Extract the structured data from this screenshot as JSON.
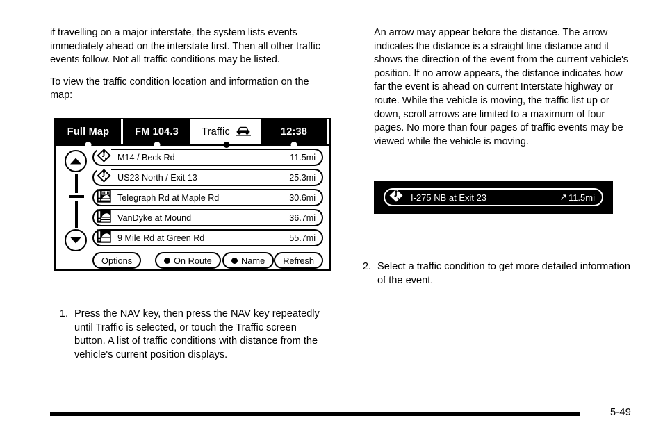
{
  "document": {
    "page_number": "5-49"
  },
  "left_column": {
    "paragraphs": [
      "if travelling on a major interstate, the system lists events immediately ahead on the interstate first. Then all other traffic events follow. Not all traffic conditions may be listed.",
      "To view the traffic condition location and information on the map:"
    ]
  },
  "right_column": {
    "paragraphs": [
      "An arrow may appear before the distance. The arrow indicates the distance is a straight line distance and it shows the direction of the event from the current vehicle's position. If no arrow appears, the distance indicates how far the event is ahead on current Interstate highway or route. While the vehicle is moving, the traffic list up or down, scroll arrows are limited to a maximum of four pages. No more than four pages of traffic events may be viewed while the vehicle is moving."
    ]
  },
  "steps": [
    {
      "number": "1.",
      "text": "Press the NAV key, then press the NAV key repeatedly until Traffic is selected, or touch the Traffic screen button. A list of traffic conditions with distance from the vehicle's current position displays."
    },
    {
      "number": "2.",
      "text": "Select a traffic condition to get more detailed information of the event."
    }
  ],
  "nav_screen": {
    "tabs": [
      {
        "label": "Full Map",
        "selected": false,
        "icon": ""
      },
      {
        "label": "FM 104.3",
        "selected": false,
        "icon": ""
      },
      {
        "label": "Traffic",
        "selected": true,
        "icon": "car-icon"
      },
      {
        "label": "12:38",
        "selected": false,
        "icon": ""
      }
    ],
    "scroll": {
      "up_label": "scroll-up",
      "down_label": "scroll-down"
    },
    "rows": [
      {
        "icon": "diamond-incident-icon",
        "label": "M14 / Beck Rd",
        "distance": "11.5mi"
      },
      {
        "icon": "diamond-incident-icon",
        "label": "US23 North / Exit 13",
        "distance": "25.3mi"
      },
      {
        "icon": "square-construction-icon",
        "label": "Telegraph Rd at Maple Rd",
        "distance": "30.6mi"
      },
      {
        "icon": "square-roadwork-icon",
        "label": "VanDyke at Mound",
        "distance": "36.7mi"
      },
      {
        "icon": "square-roadwork-icon",
        "label": "9 Mile Rd at Green Rd",
        "distance": "55.7mi"
      }
    ],
    "buttons": {
      "options": "Options",
      "on_route": "On Route",
      "name": "Name",
      "refresh": "Refresh"
    }
  },
  "callout": {
    "icon": "diamond-incident-icon",
    "label": "I-275 NB at Exit 23",
    "arrow": "↗",
    "distance": "11.5mi"
  },
  "colors": {
    "ink": "#000000",
    "paper": "#ffffff"
  }
}
